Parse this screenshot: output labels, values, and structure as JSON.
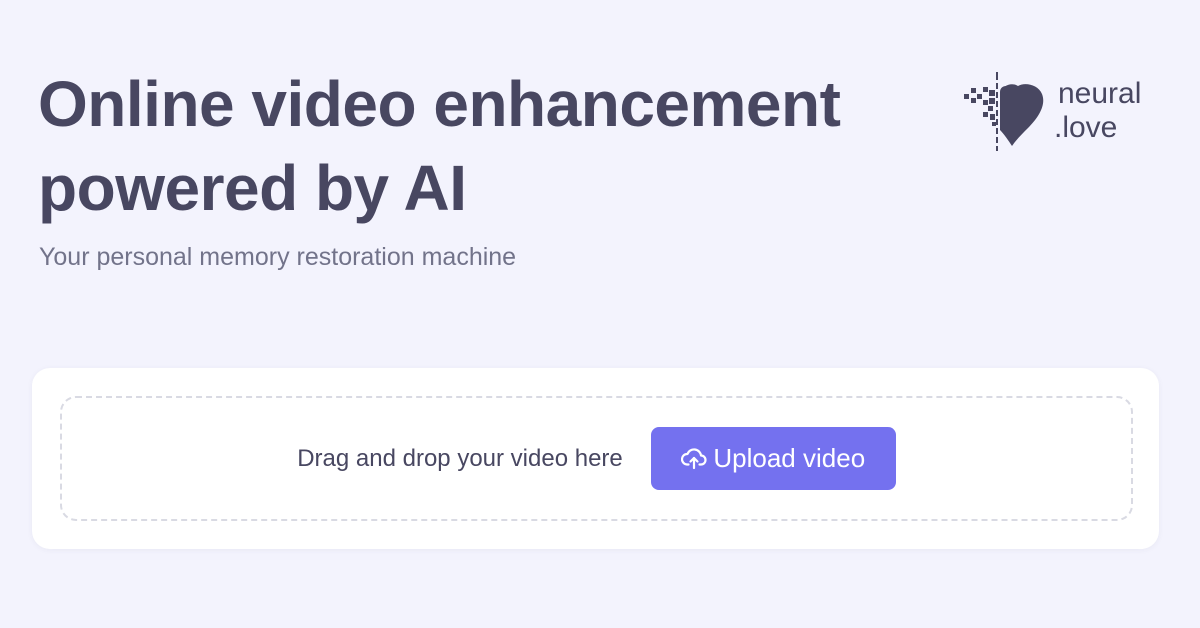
{
  "header": {
    "title_line1": "Online video enhancement",
    "title_line2": "powered by AI",
    "subtitle": "Your personal memory restoration machine"
  },
  "logo": {
    "line1": "neural",
    "line2": ".love",
    "icon": "pixel-heart-icon",
    "color": "#484761"
  },
  "upload": {
    "drop_text": "Drag and drop your video here",
    "button_label": "Upload video",
    "button_icon": "cloud-upload-icon",
    "button_color": "#7471ef"
  },
  "colors": {
    "background": "#f3f3fd",
    "text_dark": "#484761",
    "text_muted": "#72738a"
  }
}
